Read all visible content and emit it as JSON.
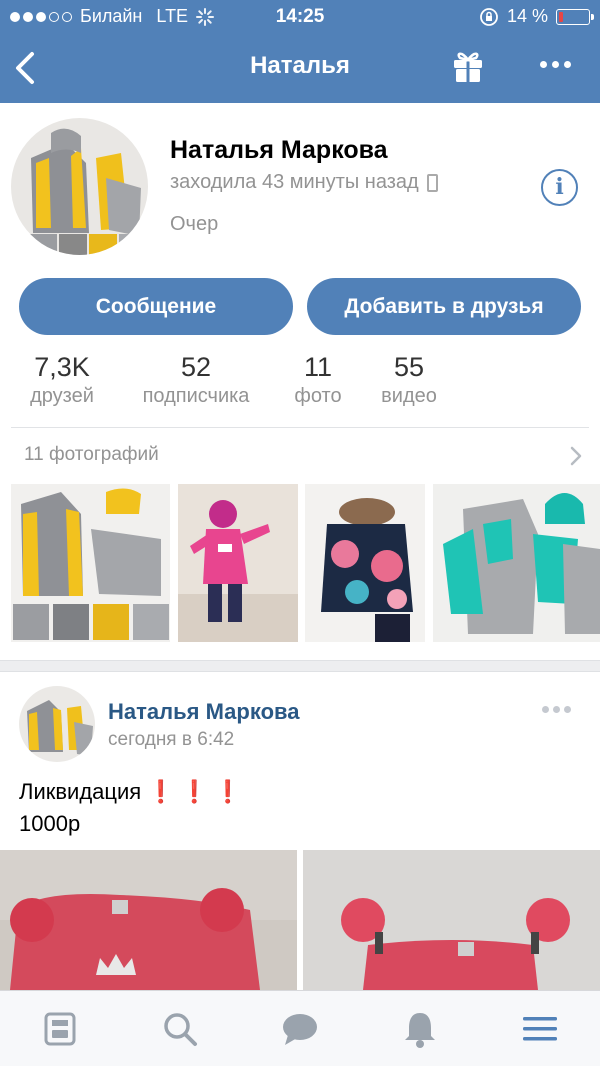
{
  "status": {
    "carrier": "Билайн",
    "network": "LTE",
    "time": "14:25",
    "battery": "14 %",
    "battery_level": 0.14
  },
  "nav": {
    "title": "Наталья"
  },
  "profile": {
    "name": "Наталья Маркова",
    "last_seen": "заходила 43 минуты назад",
    "city": "Очер",
    "message_button": "Сообщение",
    "add_friend_button": "Добавить в друзья",
    "info_icon": "i"
  },
  "counters": [
    {
      "value": "7,3K",
      "label": "друзей"
    },
    {
      "value": "52",
      "label": "подписчика"
    },
    {
      "value": "11",
      "label": "фото"
    },
    {
      "value": "55",
      "label": "видео"
    }
  ],
  "photos": {
    "header": "11 фотографий"
  },
  "post": {
    "author": "Наталья Маркова",
    "time": "сегодня в 6:42",
    "text_line1": "Ликвидация",
    "exclamations": "❗ ❗ ❗",
    "text_line2": "1000р"
  },
  "colors": {
    "brand": "#5181b8",
    "link": "#2a5885",
    "muted": "#939393"
  },
  "icons": {
    "tab_news": "news-icon",
    "tab_search": "search-icon",
    "tab_messages": "messages-icon",
    "tab_notifications": "bell-icon",
    "tab_menu": "menu-icon"
  }
}
